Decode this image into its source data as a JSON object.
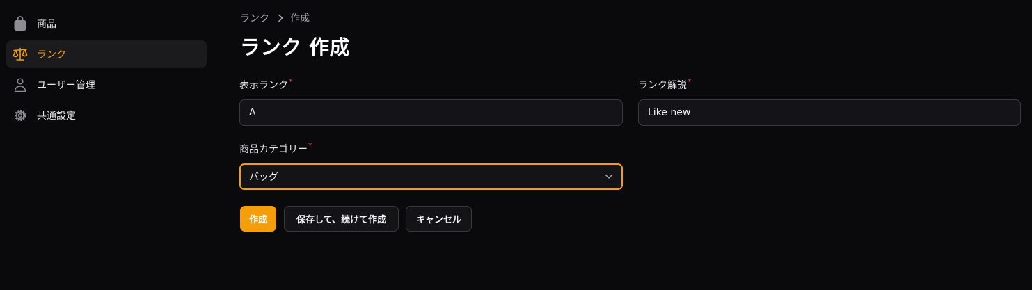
{
  "sidebar": {
    "items": [
      {
        "label": "商品",
        "icon": "shopping-bag-icon",
        "active": false
      },
      {
        "label": "ランク",
        "icon": "scale-icon",
        "active": true
      },
      {
        "label": "ユーザー管理",
        "icon": "user-icon",
        "active": false
      },
      {
        "label": "共通設定",
        "icon": "gear-icon",
        "active": false
      }
    ]
  },
  "breadcrumb": {
    "items": [
      "ランク",
      "作成"
    ]
  },
  "page": {
    "title": "ランク 作成"
  },
  "form": {
    "display_rank": {
      "label": "表示ランク",
      "required_mark": "*",
      "value": "A"
    },
    "rank_description": {
      "label": "ランク解説",
      "required_mark": "*",
      "value": "Like new"
    },
    "product_category": {
      "label": "商品カテゴリー",
      "required_mark": "*",
      "value": "バッグ"
    }
  },
  "actions": {
    "create_label": "作成",
    "save_continue_label": "保存して、続けて作成",
    "cancel_label": "キャンセル"
  },
  "colors": {
    "accent": "#f59e0b",
    "background": "#0a0a0c",
    "required": "#ef4444"
  }
}
